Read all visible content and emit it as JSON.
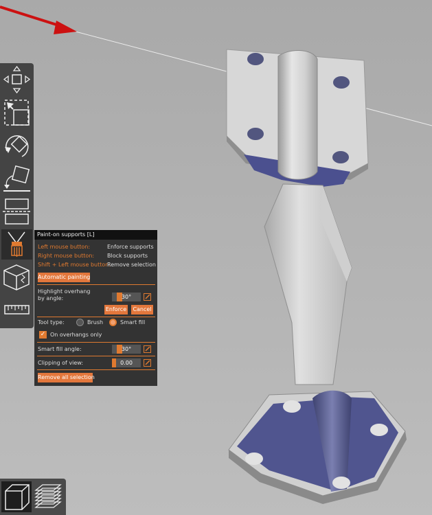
{
  "colors": {
    "accent": "#e07a30",
    "panel_bg": "#333333",
    "toolbar_bg": "#444444",
    "model": "#c8c8c8",
    "painted_support": "#4a4f8c"
  },
  "toolbar": {
    "items": [
      {
        "name": "move-tool",
        "icon": "move-icon"
      },
      {
        "name": "scale-tool",
        "icon": "scale-icon"
      },
      {
        "name": "rotate-tool",
        "icon": "rotate-icon"
      },
      {
        "name": "place-on-face-tool",
        "icon": "place-on-face-icon"
      },
      {
        "name": "cut-tool",
        "icon": "cut-icon"
      },
      {
        "name": "support-paint-tool",
        "icon": "paint-brush-icon",
        "active": true
      },
      {
        "name": "seam-paint-tool",
        "icon": "seam-icon"
      },
      {
        "name": "measure-tool",
        "icon": "ruler-icon"
      }
    ]
  },
  "panel": {
    "title": "Paint-on supports [L]",
    "hints": [
      {
        "key": "Left mouse button:",
        "action": "Enforce supports"
      },
      {
        "key": "Right mouse button:",
        "action": "Block supports"
      },
      {
        "key": "Shift + Left mouse button:",
        "action": "Remove selection"
      }
    ],
    "automatic_painting_label": "Automatic painting",
    "highlight_label_1": "Highlight overhang",
    "highlight_label_2": "by angle:",
    "highlight_value": "30°",
    "enforce_label": "Enforce",
    "cancel_label": "Cancel",
    "tool_type_label": "Tool type:",
    "brush_label": "Brush",
    "smart_fill_label": "Smart fill",
    "tool_type_selected": "Smart fill",
    "overhangs_only_label": "On overhangs only",
    "overhangs_only_checked": true,
    "smart_fill_angle_label": "Smart fill angle:",
    "smart_fill_angle_value": "30°",
    "clipping_label": "Clipping of view:",
    "clipping_value": "0.00",
    "remove_all_label": "Remove all selection"
  },
  "view_switch": {
    "items": [
      {
        "name": "3d-view-button",
        "icon": "cube-icon",
        "active": true
      },
      {
        "name": "preview-button",
        "icon": "layers-icon"
      }
    ]
  }
}
